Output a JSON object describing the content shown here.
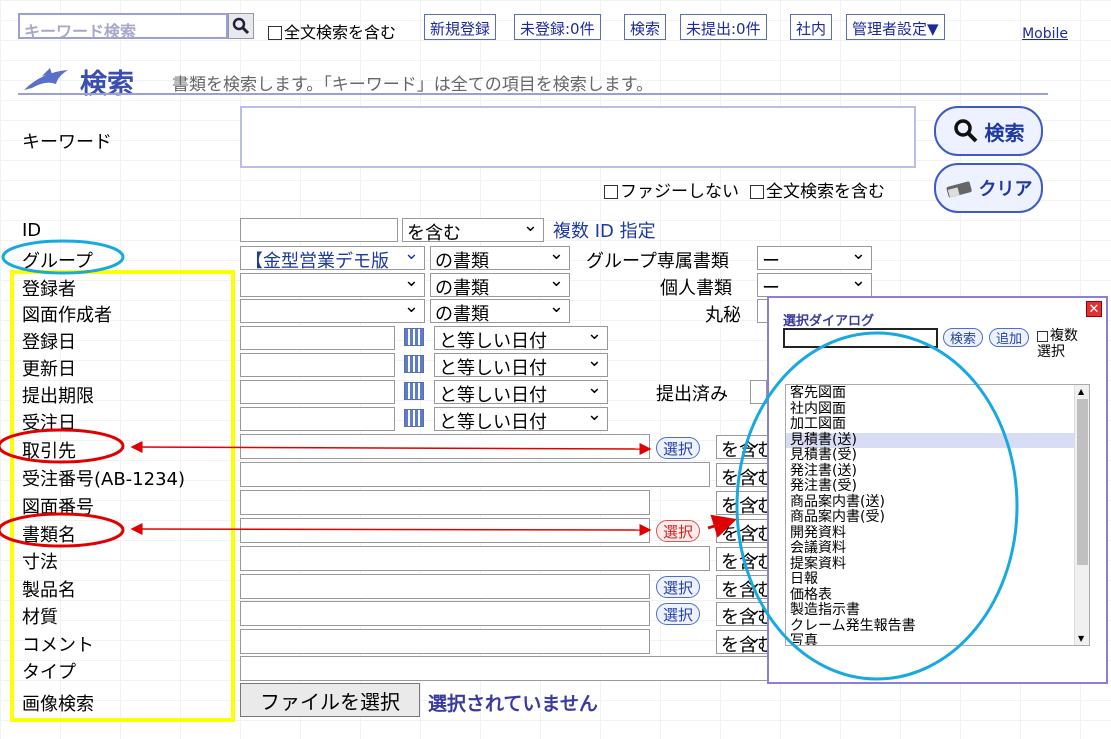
{
  "topbar": {
    "keyword_placeholder": "キーワード検索",
    "fulltext_label": "全文検索を含む",
    "nav": [
      "新規登録",
      "未登録:0件",
      "検索",
      "未提出:0件",
      "社内",
      "管理者設定▼"
    ],
    "mobile": "Mobile"
  },
  "header": {
    "title": "検索",
    "subtitle": "書類を検索します。「キーワード」は全ての項目を検索します。"
  },
  "keyword": {
    "label": "キーワード",
    "fuzzy": "ファジーしない",
    "fulltext": "全文検索を含む",
    "search_btn": "検索",
    "clear_btn": "クリア"
  },
  "fields": {
    "id": "ID",
    "group": "グループ",
    "registrant": "登録者",
    "drawing_creator": "図面作成者",
    "reg_date": "登録日",
    "upd_date": "更新日",
    "deadline": "提出期限",
    "order_date": "受注日",
    "client": "取引先",
    "order_no": "受注番号(AB-1234)",
    "drawing_no": "図面番号",
    "doc_name": "書類名",
    "dimension": "寸法",
    "product": "製品名",
    "material": "材質",
    "comment": "コメント",
    "type": "タイプ",
    "image_search": "画像検索"
  },
  "selects": {
    "contains": "を含む",
    "multi_id": "複数 ID 指定",
    "group_value": "【金型営業デモ版",
    "of_docs": "の書類",
    "date_eq": "と等しい日付",
    "group_exclusive": "グループ専属書類",
    "personal": "個人書類",
    "secret": "丸秘",
    "dash": "ー",
    "submitted": "提出済み",
    "contains_short": "を含む"
  },
  "buttons": {
    "select": "選択",
    "file_select": "ファイルを選択",
    "no_file": "選択されていません"
  },
  "dialog": {
    "title": "選択ダイアログ",
    "search": "検索",
    "add": "追加",
    "multi": "複数",
    "multi2": "選択",
    "items": [
      "客先図面",
      "社内図面",
      "加工図面",
      "見積書(送)",
      "見積書(受)",
      "発注書(送)",
      "発注書(受)",
      "商品案内書(送)",
      "商品案内書(受)",
      "開発資料",
      "会議資料",
      "提案資料",
      "日報",
      "価格表",
      "製造指示書",
      "クレーム発生報告書",
      "写真"
    ],
    "selected_index": 3
  },
  "colors": {
    "accent": "#3a4fb0",
    "annotation_red": "#e00000",
    "annotation_blue": "#17a9e0",
    "annotation_yellow": "#ffff00"
  }
}
